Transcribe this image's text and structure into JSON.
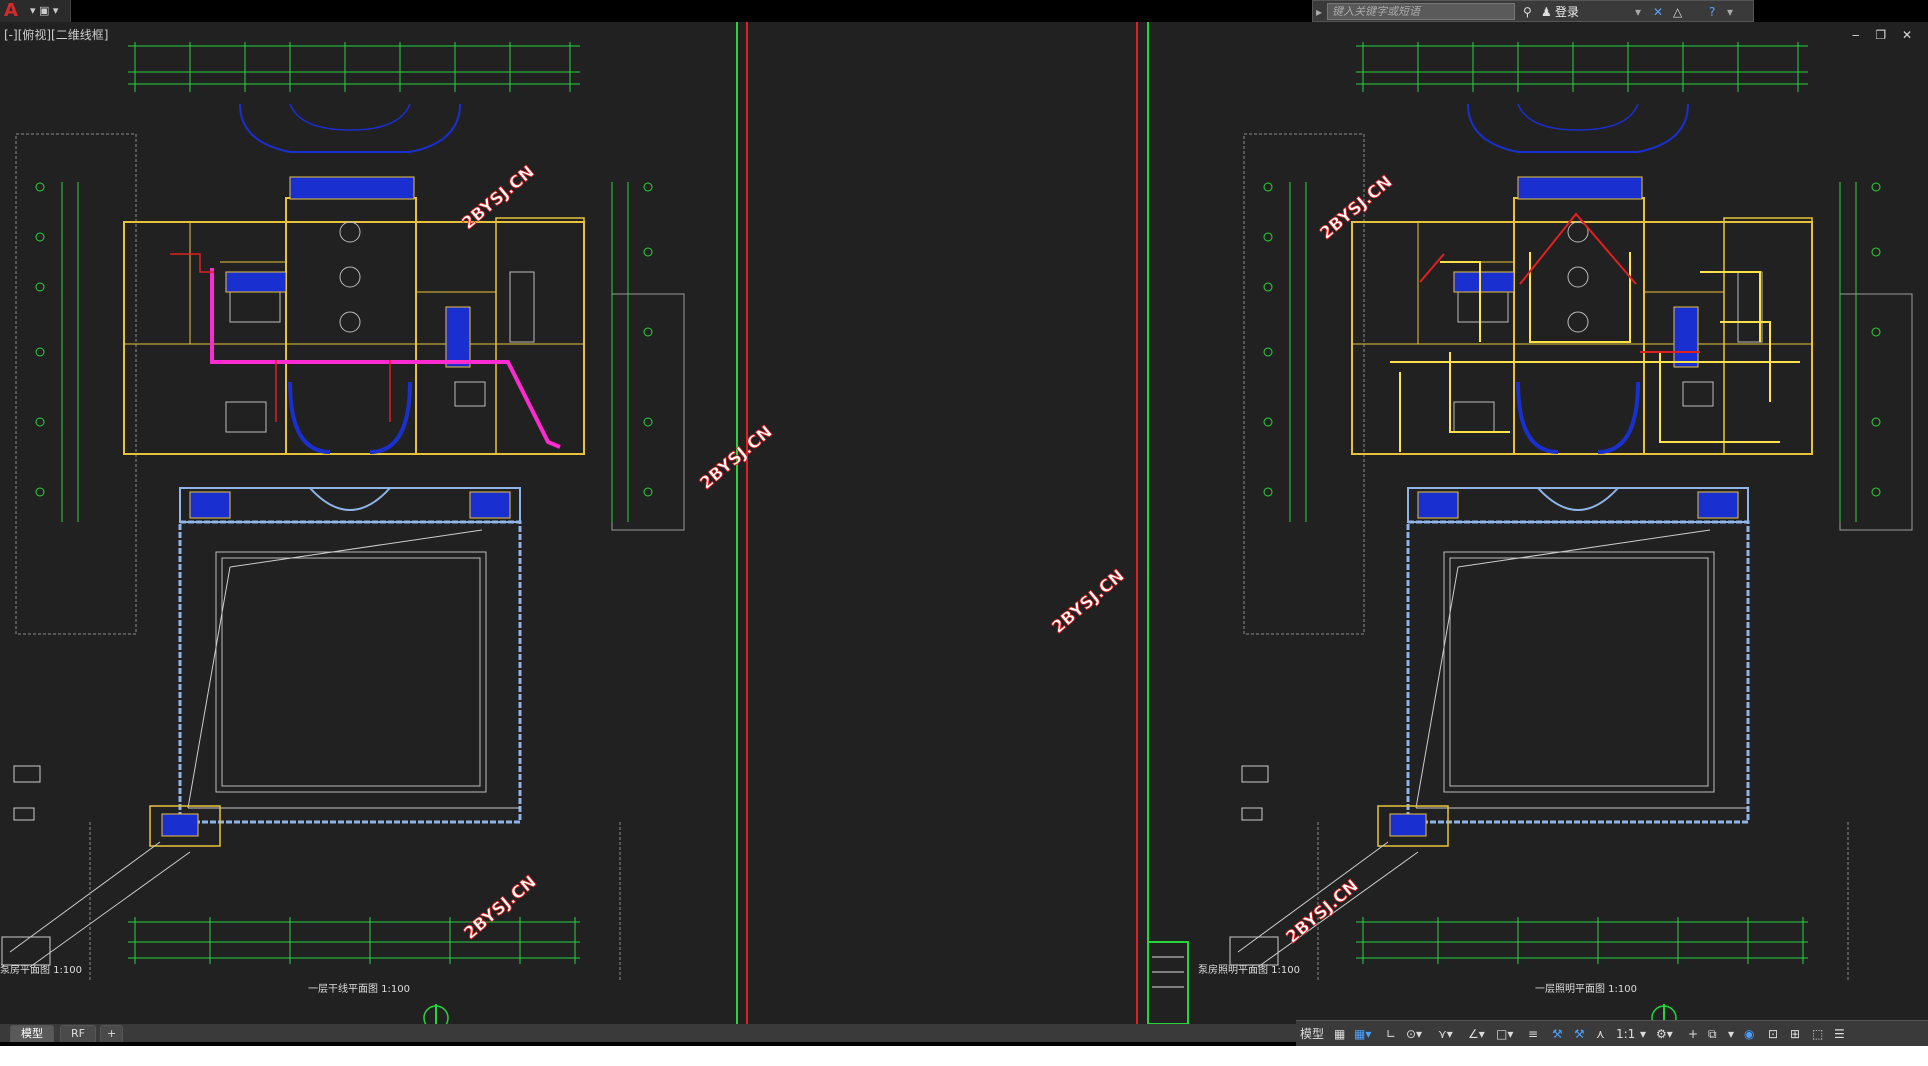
{
  "titlebar": {
    "search_placeholder": "键入关键字或短语",
    "login_label": "登录",
    "help_icon": "help-icon"
  },
  "viewport": {
    "label": "[-][俯视][二维线框]"
  },
  "drawing": {
    "left_plan_title": "一层干线平面图  1:100",
    "right_plan_title": "一层照明平面图  1:100",
    "left_partial_title": "泵房平面图  1:100",
    "right_partial_title": "泵房照明平面图  1:100",
    "watermark": "2BYSJ.CN"
  },
  "tabs": [
    {
      "label": "模型"
    },
    {
      "label": "RF"
    },
    {
      "label": "+"
    }
  ],
  "statusbar": {
    "model_label": "模型",
    "scale_label": "1:1"
  },
  "colors": {
    "canvas_bg": "#212121",
    "wall": "#e8c23a",
    "dim": "#27d43a",
    "feeder": "#ff2ad0",
    "circuit": "#ffe14a",
    "red": "#e02020",
    "pool": "#8fb4e8",
    "blue_fill": "#1a2fd0"
  }
}
